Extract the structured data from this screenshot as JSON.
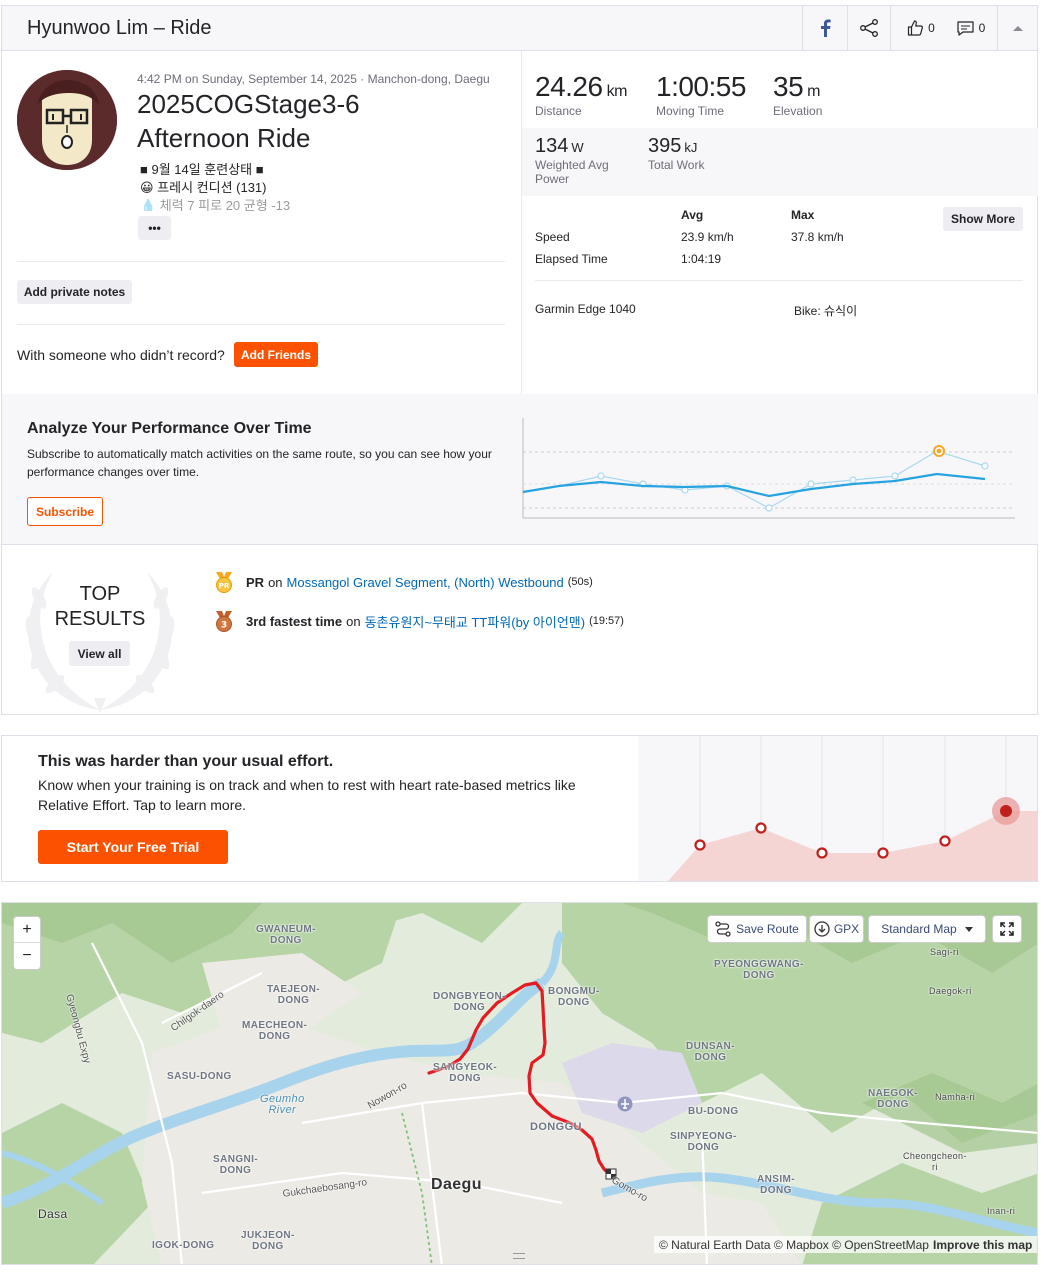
{
  "header": {
    "title": "Hyunwoo Lim – Ride",
    "kudos_count": "0",
    "comment_count": "0"
  },
  "activity": {
    "datetime": "4:42 PM on Sunday, September 14, 2025 · Manchon-dong, Daegu",
    "name_line1": "2025COGStage3-6",
    "name_line2": "Afternoon Ride",
    "desc_line1": "■ 9월 14일 훈련상태 ■",
    "desc_line2": "😀 프레시 컨디션 (131)",
    "desc_line3": "💧 체력 7  피로 20  균형 -13",
    "more_label": "•••",
    "private_notes_label": "Add private notes",
    "record_prompt": "With someone who didn’t record?",
    "add_friends_label": "Add Friends"
  },
  "stats": {
    "distance_value": "24.26",
    "distance_unit": "km",
    "distance_label": "Distance",
    "moving_time_value": "1:00:55",
    "moving_time_label": "Moving Time",
    "elevation_value": "35",
    "elevation_unit": "m",
    "elevation_label": "Elevation",
    "power_value": "134",
    "power_unit": "W",
    "power_label": "Weighted Avg Power",
    "work_value": "395",
    "work_unit": "kJ",
    "work_label": "Total Work",
    "avg_header": "Avg",
    "max_header": "Max",
    "show_more_label": "Show More",
    "speed_label": "Speed",
    "speed_avg": "23.9 km/h",
    "speed_max": "37.8 km/h",
    "elapsed_label": "Elapsed Time",
    "elapsed_avg": "1:04:19",
    "device": "Garmin Edge 1040",
    "bike": "Bike: 슈식이"
  },
  "analyze": {
    "title": "Analyze Your Performance Over Time",
    "body": "Subscribe to automatically match activities on the same route, so you can see how your performance changes over time.",
    "subscribe_label": "Subscribe"
  },
  "top_results": {
    "title_line1": "TOP",
    "title_line2": "RESULTS",
    "view_all_label": "View all",
    "items": [
      {
        "badge": "PR",
        "achievement": "PR",
        "on": "on",
        "segment": "Mossangol Gravel Segment, (North) Westbound",
        "time": "(50s)"
      },
      {
        "badge": "3",
        "achievement": "3rd fastest time",
        "on": "on",
        "segment": "동촌유원지~무태교 TT파워(by 아이언맨)",
        "time": "(19:57)"
      }
    ]
  },
  "effort": {
    "title": "This was harder than your usual effort.",
    "body": "Know when your training is on track and when to rest with heart rate-based metrics like Relative Effort. Tap to learn more.",
    "cta_label": "Start Your Free Trial"
  },
  "map": {
    "zoom_in": "+",
    "zoom_out": "−",
    "save_route_label": "Save Route",
    "gpx_label": "GPX",
    "map_style_label": "Standard Map",
    "attribution": "© Natural Earth Data © Mapbox © OpenStreetMap",
    "improve_label": "Improve this map",
    "labels": {
      "gwaneum": "GWANEUM-\nDONG",
      "taejeon": "TAEJEON-\nDONG",
      "maecheon": "MAECHEON-\nDONG",
      "sasu": "SASU-DONG",
      "dongbyeon": "DONGBYEON-\nDONG",
      "bongmu": "BONGMU-\nDONG",
      "sangyeok": "SANGYEOK-\nDONG",
      "pyeonggwang": "PYEONGGWANG-\nDONG",
      "dunsan": "DUNSAN-\nDONG",
      "bu": "BU-DONG",
      "naegok": "NAEGOK-\nDONG",
      "sinpyeong": "SINPYEONG-\nDONG",
      "donggu": "DONGGU",
      "sangni": "SANGNI-\nDONG",
      "ansim": "ANSIM-\nDONG",
      "igok": "IGOK-DONG",
      "jukjeon": "JUKJEON-\nDONG",
      "daegu": "Daegu",
      "dasa": "Dasa",
      "sagi": "Sagi-ri",
      "daegok": "Daegok-ri",
      "namha": "Namha-ri",
      "cheongcheon": "Cheongcheon-\nri",
      "inan": "Inan-ri",
      "geumho": "Geumho\nRiver",
      "gyeongbu": "Gyeongbu Expy",
      "chilgok": "Chilgok-daero",
      "nowon": "Nowon-ro",
      "gukchae": "Gukchaebosang-ro",
      "gomo": "Gomo-ro"
    }
  }
}
